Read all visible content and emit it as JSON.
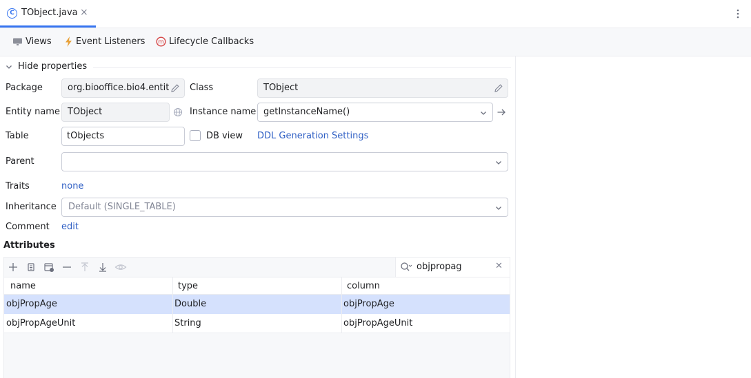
{
  "tab": {
    "title": "TObject.java",
    "icon": "class-icon",
    "close": "×"
  },
  "toolbar": {
    "items": [
      {
        "label": "Views",
        "icon": "monitor-icon"
      },
      {
        "label": "Event Listeners",
        "icon": "lightning-icon"
      },
      {
        "label": "Lifecycle Callbacks",
        "icon": "lifecycle-m-icon"
      }
    ]
  },
  "properties": {
    "toggle_label": "Hide properties",
    "package_label": "Package",
    "package_value": "org.biooffice.bio4.entit",
    "class_label": "Class",
    "class_value": "TObject",
    "entity_name_label": "Entity name",
    "entity_name_value": "TObject",
    "instance_name_label": "Instance name",
    "instance_name_value": "getInstanceName()",
    "table_label": "Table",
    "table_value": "tObjects",
    "db_view_label": "DB view",
    "db_view_checked": false,
    "ddl_link": "DDL Generation Settings",
    "parent_label": "Parent",
    "parent_value": "",
    "traits_label": "Traits",
    "traits_value": "none",
    "inheritance_label": "Inheritance",
    "inheritance_value": "Default (SINGLE_TABLE)",
    "comment_label": "Comment",
    "comment_value": "edit"
  },
  "attributes": {
    "title": "Attributes",
    "search_value": "objpropag",
    "columns": [
      "name",
      "type",
      "column"
    ],
    "rows": [
      {
        "name": "objPropAge",
        "type": "Double",
        "column": "objPropAge",
        "selected": true
      },
      {
        "name": "objPropAgeUnit",
        "type": "String",
        "column": "objPropAgeUnit",
        "selected": false
      }
    ]
  },
  "colors": {
    "accent": "#3574f0",
    "link": "#2f5fc4",
    "selection": "#d5e1fd",
    "lightning": "#e8a23b",
    "lifecycle": "#d64545"
  }
}
